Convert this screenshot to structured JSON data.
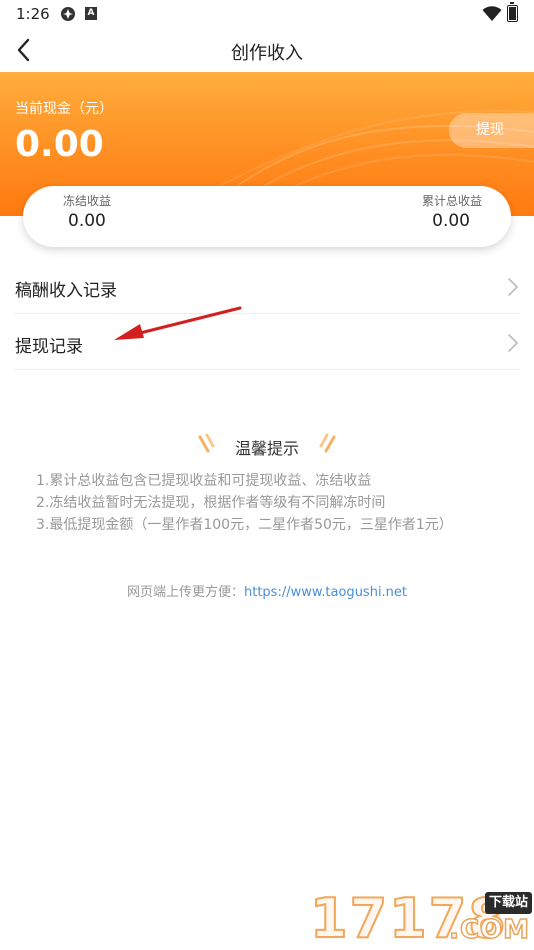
{
  "status_bar": {
    "time": "1:26",
    "notification_icon_b": "A"
  },
  "nav": {
    "title": "创作收入",
    "back_icon": "chevron-left-icon"
  },
  "balance": {
    "label": "当前现金（元）",
    "value": "0.00",
    "withdraw_label": "提现"
  },
  "stats": {
    "frozen_label": "冻结收益",
    "frozen_value": "0.00",
    "total_label": "累计总收益",
    "total_value": "0.00"
  },
  "menu": {
    "items": [
      {
        "label": "稿酬收入记录"
      },
      {
        "label": "提现记录"
      }
    ]
  },
  "tips": {
    "title": "温馨提示",
    "lines": [
      "1.累计总收益包含已提现收益和可提现收益、冻结收益",
      "2.冻结收益暂时无法提现，根据作者等级有不同解冻时间",
      "3.最低提现金额（一星作者100元，二星作者50元，三星作者1元）"
    ]
  },
  "footer": {
    "label": "网页端上传更方便：",
    "url": "https://www.taogushi.net"
  },
  "watermark": {
    "digits": "17178",
    "badge": "下载站",
    "suffix": ".COM"
  },
  "colors": {
    "accent_orange": "#ff8f22",
    "link_blue": "#4a8fd9",
    "annotation_red": "#d41f1f"
  }
}
